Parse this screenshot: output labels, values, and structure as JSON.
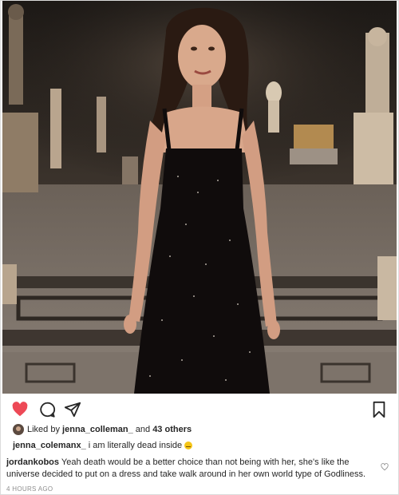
{
  "post": {
    "liked_by_prefix": "Liked by",
    "liked_by_user": "jenna_colleman_",
    "liked_by_and": "and",
    "liked_by_others": "43 others",
    "caption_user": "jenna_colemanx_",
    "caption_text": "i am literally dead inside",
    "comment_user": "jordankobos",
    "comment_text": "Yeah death would be a better choice than not being with her, she's like the universe decided to put on a dress and take walk around in her own world type of Godliness.",
    "timestamp": "4 HOURS AGO"
  },
  "icons": {
    "like": "heart-filled-icon",
    "comment": "comment-bubble-icon",
    "share": "paper-plane-icon",
    "save": "bookmark-icon",
    "comment_like": "heart-outline-icon"
  },
  "colors": {
    "like_red": "#ed4956",
    "text": "#262626",
    "muted": "#8e8e8e"
  }
}
